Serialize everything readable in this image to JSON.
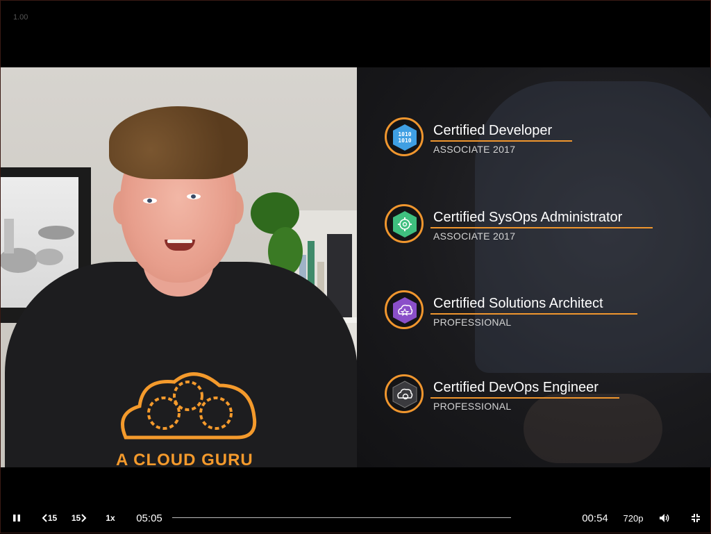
{
  "overlay": {
    "speed_readout": "1.00"
  },
  "tshirt": {
    "text": "A CLOUD GURU"
  },
  "certifications": [
    {
      "title": "Certified Developer",
      "level": "ASSOCIATE 2017",
      "badge_icon": "binary-code-icon",
      "badge_color": "#3f9fe3"
    },
    {
      "title": "Certified SysOps Administrator",
      "level": "ASSOCIATE 2017",
      "badge_icon": "gear-icon",
      "badge_color": "#3fbf7f"
    },
    {
      "title": "Certified Solutions Architect",
      "level": "PROFESSIONAL",
      "badge_icon": "cloud-star-icon",
      "badge_color": "#8a4fc9"
    },
    {
      "title": "Certified DevOps Engineer",
      "level": "PROFESSIONAL",
      "badge_icon": "cloud-gear-icon",
      "badge_color": "#3a3a3e"
    }
  ],
  "badge_texts": {
    "binary": "1010\n1010"
  },
  "controls": {
    "pause_icon": "pause-icon",
    "rewind_label": "15",
    "forward_label": "15",
    "speed_label": "1x",
    "elapsed": "05:05",
    "remaining": "00:54",
    "quality": "720p",
    "volume_icon": "volume-icon",
    "exit_fullscreen_icon": "exit-fullscreen-icon",
    "progress": 0.0
  },
  "colors": {
    "accent": "#f0962e",
    "background": "#000000"
  }
}
